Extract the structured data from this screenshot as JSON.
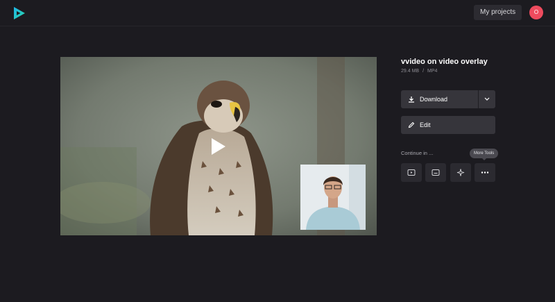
{
  "header": {
    "logo_icon": "play-logo-icon",
    "my_projects_label": "My projects",
    "avatar_initial": "O",
    "avatar_color": "#ee4b5e",
    "brand_colors": [
      "#1fb6e8",
      "#2ad6a8"
    ]
  },
  "video": {
    "play_icon": "play-icon",
    "overlay_description_icon": "webcam-overlay"
  },
  "details": {
    "title": "vvideo on video overlay",
    "size": "29.4 MB",
    "separator": "/",
    "format": "MP4"
  },
  "actions": {
    "download_label": "Download",
    "download_icon": "download-icon",
    "dropdown_icon": "chevron-down-icon",
    "edit_label": "Edit",
    "edit_icon": "pencil-icon"
  },
  "continue_in": {
    "label": "Continue in ...",
    "tooltip": "More Tools",
    "tools": [
      {
        "icon": "youtube-icon"
      },
      {
        "icon": "subtitles-icon"
      },
      {
        "icon": "sparkle-icon"
      },
      {
        "icon": "more-icon"
      }
    ]
  }
}
